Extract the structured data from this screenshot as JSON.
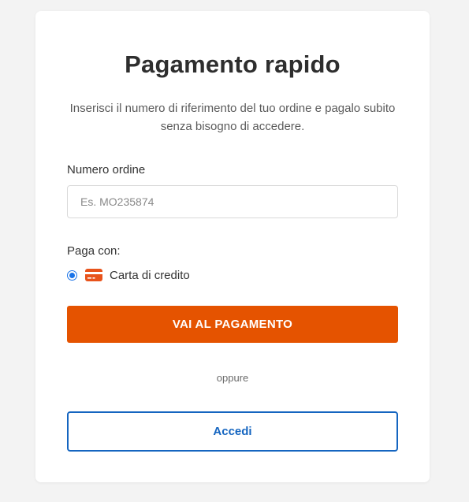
{
  "page": {
    "title": "Pagamento rapido",
    "subtitle": "Inserisci il numero di riferimento del tuo ordine e pagalo subito senza bisogno di accedere."
  },
  "order_field": {
    "label": "Numero ordine",
    "value": "",
    "placeholder": "Es. MO235874"
  },
  "payment": {
    "label": "Paga con:",
    "options": [
      {
        "label": "Carta di credito",
        "icon": "credit-card-icon",
        "selected": true
      }
    ]
  },
  "actions": {
    "pay_label": "VAI AL PAGAMENTO",
    "separator": "oppure",
    "login_label": "Accedi"
  },
  "colors": {
    "background": "#f3f3f3",
    "card": "#ffffff",
    "primary_orange": "#e55300",
    "link_blue": "#1565c0",
    "radio_blue": "#1a73e8",
    "card_icon": "#e8531b"
  }
}
